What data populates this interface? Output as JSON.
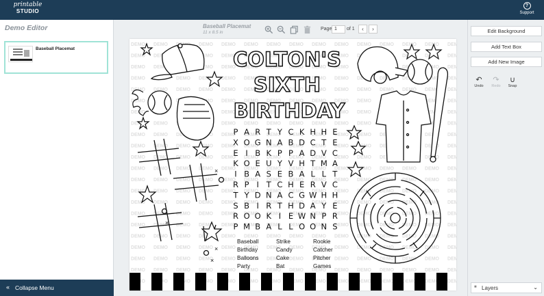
{
  "app": {
    "logo_line1": "printable",
    "logo_line2": "STUDIO",
    "support_label": "Support",
    "support_glyph": "?"
  },
  "left_panel": {
    "title": "Demo Editor",
    "pages": [
      {
        "title": "Baseball Placemat"
      }
    ],
    "collapse_label": "Collapse Menu",
    "collapse_glyph": "«"
  },
  "editor": {
    "doc_title": "Baseball Placemat",
    "doc_size": "11 x 8.5 in",
    "page_label": "Page",
    "page_value": "1",
    "page_of": "of 1",
    "prev_glyph": "‹",
    "next_glyph": "›",
    "tools": [
      "zoom-in-icon",
      "zoom-out-icon",
      "copy-icon",
      "trash-icon"
    ]
  },
  "canvas": {
    "watermark": "DEMO",
    "title_lines": [
      "COLTON'S",
      "SIXTH",
      "BIRTHDAY"
    ],
    "grid": [
      "PARTYCKHHE",
      "XOGNABDCTE",
      "EIBKPPADVC",
      "KOEUYVHTMA",
      "IBASEBALLT",
      "RPITCHERVC",
      "TYDNACGWHH",
      "SBIRTHDAYE",
      "ROOKIEWNPR",
      "PMBALLOONS"
    ],
    "word_columns": [
      [
        "Baseball",
        "Birthday",
        "Balloons",
        "Party"
      ],
      [
        "Strike",
        "Candy",
        "Cake",
        "Bat"
      ],
      [
        "Rookie",
        "Catcher",
        "Pitcher",
        "Games"
      ]
    ]
  },
  "right_panel": {
    "buttons": [
      "Edit Background",
      "Add Text Box",
      "Add New Image"
    ],
    "undo": "Undo",
    "redo": "Redo",
    "snap": "Snap",
    "layers_label": "Layers"
  },
  "colors": {
    "topbar": "#1d3d57",
    "accent": "#9fe3d6",
    "workspace": "#eceff1"
  }
}
